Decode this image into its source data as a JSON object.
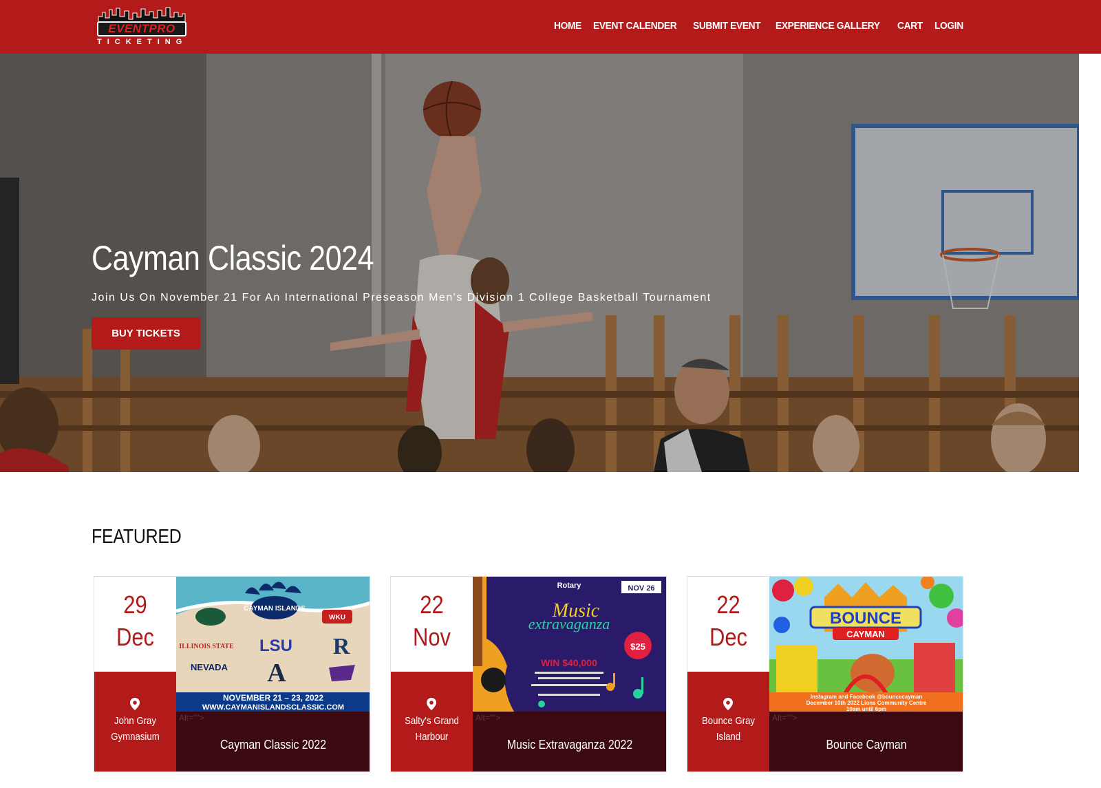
{
  "header": {
    "logo_main": "EVENTPRO",
    "logo_sub": "TICKETING",
    "nav": [
      "HOME",
      "EVENT CALENDER",
      "SUBMIT EVENT",
      "EXPERIENCE GALLERY",
      "CART",
      "LOGIN"
    ]
  },
  "hero": {
    "title": "Cayman Classic 2024",
    "subtitle": "Join Us On November 21 For An International Preseason Men's Division 1 College Basketball Tournament",
    "button": "BUY TICKETS"
  },
  "featured": {
    "heading": "FEATURED",
    "cards": [
      {
        "day": "29",
        "month": "Dec",
        "venue": "John Gray Gymnasium",
        "alt": "Alt=\"\">",
        "title": "Cayman Classic 2022",
        "image": {
          "logo_title": "CAYMAN ISLANDS",
          "teams": [
            "LSU",
            "R",
            "A",
            "NEVADA",
            "WKU",
            "ILLINOIS STATE"
          ],
          "footer_dates": "NOVEMBER 21 – 23, 2022",
          "footer_url": "WWW.CAYMANISLANDSCLASSIC.COM"
        }
      },
      {
        "day": "22",
        "month": "Nov",
        "venue": "Salty's Grand Harbour",
        "alt": "Alt=\"\">",
        "title": "Music Extravaganza 2022",
        "image": {
          "org": "Rotary",
          "date_badge": "NOV 26",
          "headline1": "Music",
          "headline2": "extravaganza",
          "prize": "WIN $40,000",
          "price": "$25"
        }
      },
      {
        "day": "22",
        "month": "Dec",
        "venue": "Bounce Gray Island",
        "alt": "Alt=\"\">",
        "title": "Bounce Cayman",
        "image": {
          "headline1": "BOUNCE",
          "headline2": "CAYMAN",
          "line1": "Instagram and Facebook @bouncecayman",
          "line2": "December 10th 2022    Lions Community Centre",
          "line3": "10am until 6pm"
        }
      }
    ]
  },
  "colors": {
    "brand_red": "#b31b1b",
    "dark_maroon": "#3a0a10"
  }
}
